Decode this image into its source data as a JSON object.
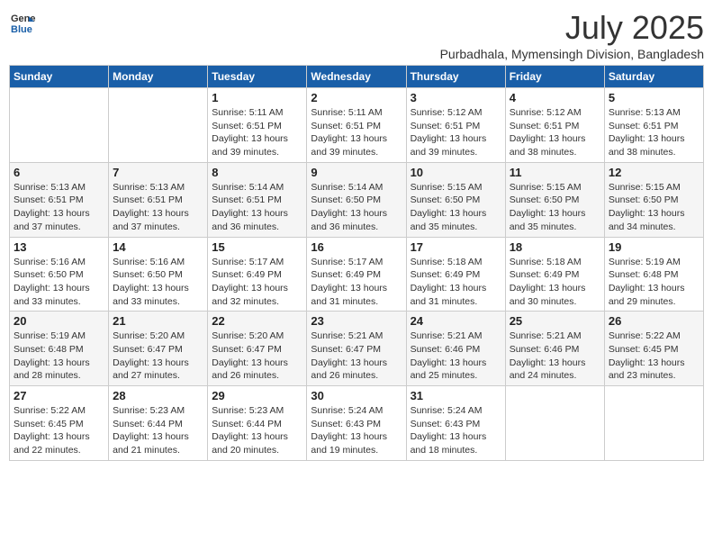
{
  "logo": {
    "line1": "General",
    "line2": "Blue"
  },
  "title": "July 2025",
  "subtitle": "Purbadhala, Mymensingh Division, Bangladesh",
  "weekdays": [
    "Sunday",
    "Monday",
    "Tuesday",
    "Wednesday",
    "Thursday",
    "Friday",
    "Saturday"
  ],
  "weeks": [
    [
      {
        "day": "",
        "content": ""
      },
      {
        "day": "",
        "content": ""
      },
      {
        "day": "1",
        "content": "Sunrise: 5:11 AM\nSunset: 6:51 PM\nDaylight: 13 hours\nand 39 minutes."
      },
      {
        "day": "2",
        "content": "Sunrise: 5:11 AM\nSunset: 6:51 PM\nDaylight: 13 hours\nand 39 minutes."
      },
      {
        "day": "3",
        "content": "Sunrise: 5:12 AM\nSunset: 6:51 PM\nDaylight: 13 hours\nand 39 minutes."
      },
      {
        "day": "4",
        "content": "Sunrise: 5:12 AM\nSunset: 6:51 PM\nDaylight: 13 hours\nand 38 minutes."
      },
      {
        "day": "5",
        "content": "Sunrise: 5:13 AM\nSunset: 6:51 PM\nDaylight: 13 hours\nand 38 minutes."
      }
    ],
    [
      {
        "day": "6",
        "content": "Sunrise: 5:13 AM\nSunset: 6:51 PM\nDaylight: 13 hours\nand 37 minutes."
      },
      {
        "day": "7",
        "content": "Sunrise: 5:13 AM\nSunset: 6:51 PM\nDaylight: 13 hours\nand 37 minutes."
      },
      {
        "day": "8",
        "content": "Sunrise: 5:14 AM\nSunset: 6:51 PM\nDaylight: 13 hours\nand 36 minutes."
      },
      {
        "day": "9",
        "content": "Sunrise: 5:14 AM\nSunset: 6:50 PM\nDaylight: 13 hours\nand 36 minutes."
      },
      {
        "day": "10",
        "content": "Sunrise: 5:15 AM\nSunset: 6:50 PM\nDaylight: 13 hours\nand 35 minutes."
      },
      {
        "day": "11",
        "content": "Sunrise: 5:15 AM\nSunset: 6:50 PM\nDaylight: 13 hours\nand 35 minutes."
      },
      {
        "day": "12",
        "content": "Sunrise: 5:15 AM\nSunset: 6:50 PM\nDaylight: 13 hours\nand 34 minutes."
      }
    ],
    [
      {
        "day": "13",
        "content": "Sunrise: 5:16 AM\nSunset: 6:50 PM\nDaylight: 13 hours\nand 33 minutes."
      },
      {
        "day": "14",
        "content": "Sunrise: 5:16 AM\nSunset: 6:50 PM\nDaylight: 13 hours\nand 33 minutes."
      },
      {
        "day": "15",
        "content": "Sunrise: 5:17 AM\nSunset: 6:49 PM\nDaylight: 13 hours\nand 32 minutes."
      },
      {
        "day": "16",
        "content": "Sunrise: 5:17 AM\nSunset: 6:49 PM\nDaylight: 13 hours\nand 31 minutes."
      },
      {
        "day": "17",
        "content": "Sunrise: 5:18 AM\nSunset: 6:49 PM\nDaylight: 13 hours\nand 31 minutes."
      },
      {
        "day": "18",
        "content": "Sunrise: 5:18 AM\nSunset: 6:49 PM\nDaylight: 13 hours\nand 30 minutes."
      },
      {
        "day": "19",
        "content": "Sunrise: 5:19 AM\nSunset: 6:48 PM\nDaylight: 13 hours\nand 29 minutes."
      }
    ],
    [
      {
        "day": "20",
        "content": "Sunrise: 5:19 AM\nSunset: 6:48 PM\nDaylight: 13 hours\nand 28 minutes."
      },
      {
        "day": "21",
        "content": "Sunrise: 5:20 AM\nSunset: 6:47 PM\nDaylight: 13 hours\nand 27 minutes."
      },
      {
        "day": "22",
        "content": "Sunrise: 5:20 AM\nSunset: 6:47 PM\nDaylight: 13 hours\nand 26 minutes."
      },
      {
        "day": "23",
        "content": "Sunrise: 5:21 AM\nSunset: 6:47 PM\nDaylight: 13 hours\nand 26 minutes."
      },
      {
        "day": "24",
        "content": "Sunrise: 5:21 AM\nSunset: 6:46 PM\nDaylight: 13 hours\nand 25 minutes."
      },
      {
        "day": "25",
        "content": "Sunrise: 5:21 AM\nSunset: 6:46 PM\nDaylight: 13 hours\nand 24 minutes."
      },
      {
        "day": "26",
        "content": "Sunrise: 5:22 AM\nSunset: 6:45 PM\nDaylight: 13 hours\nand 23 minutes."
      }
    ],
    [
      {
        "day": "27",
        "content": "Sunrise: 5:22 AM\nSunset: 6:45 PM\nDaylight: 13 hours\nand 22 minutes."
      },
      {
        "day": "28",
        "content": "Sunrise: 5:23 AM\nSunset: 6:44 PM\nDaylight: 13 hours\nand 21 minutes."
      },
      {
        "day": "29",
        "content": "Sunrise: 5:23 AM\nSunset: 6:44 PM\nDaylight: 13 hours\nand 20 minutes."
      },
      {
        "day": "30",
        "content": "Sunrise: 5:24 AM\nSunset: 6:43 PM\nDaylight: 13 hours\nand 19 minutes."
      },
      {
        "day": "31",
        "content": "Sunrise: 5:24 AM\nSunset: 6:43 PM\nDaylight: 13 hours\nand 18 minutes."
      },
      {
        "day": "",
        "content": ""
      },
      {
        "day": "",
        "content": ""
      }
    ]
  ]
}
